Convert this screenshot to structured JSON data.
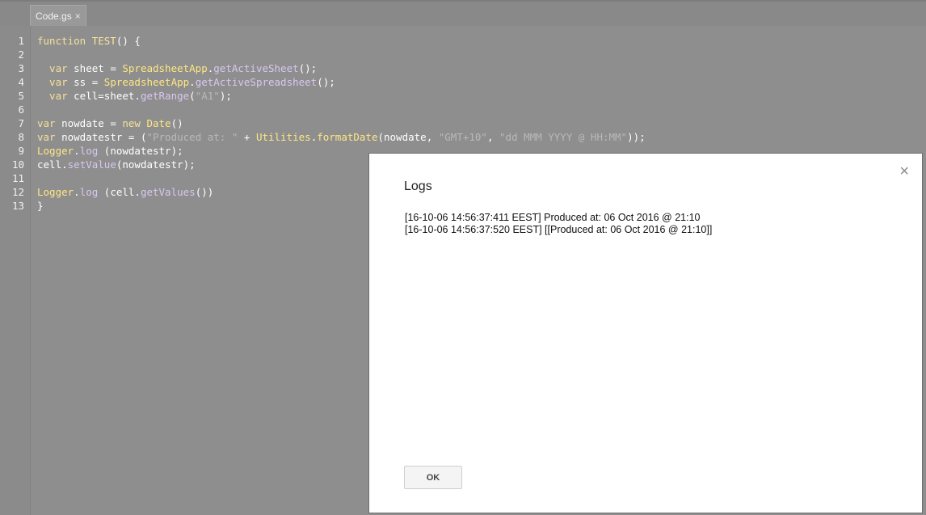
{
  "tabs": [
    {
      "label": "Code.gs",
      "close_glyph": "×"
    }
  ],
  "editor": {
    "lines": [
      {
        "no": "1",
        "tokens": [
          [
            "kw",
            "function "
          ],
          [
            "fn",
            "TEST"
          ],
          [
            "p",
            "() {"
          ]
        ]
      },
      {
        "no": "2",
        "tokens": []
      },
      {
        "no": "3",
        "tokens": [
          [
            "kw",
            "  var "
          ],
          [
            "v",
            "sheet"
          ],
          [
            "p",
            " = "
          ],
          [
            "cls",
            "SpreadsheetApp"
          ],
          [
            "p",
            "."
          ],
          [
            "m",
            "getActiveSheet"
          ],
          [
            "p",
            "();"
          ]
        ]
      },
      {
        "no": "4",
        "tokens": [
          [
            "kw",
            "  var "
          ],
          [
            "v",
            "ss"
          ],
          [
            "p",
            " = "
          ],
          [
            "cls",
            "SpreadsheetApp"
          ],
          [
            "p",
            "."
          ],
          [
            "m",
            "getActiveSpreadsheet"
          ],
          [
            "p",
            "();"
          ]
        ]
      },
      {
        "no": "5",
        "tokens": [
          [
            "kw",
            "  var "
          ],
          [
            "v",
            "cell"
          ],
          [
            "p",
            "=sheet."
          ],
          [
            "m",
            "getRange"
          ],
          [
            "p",
            "("
          ],
          [
            "s",
            "\"A1\""
          ],
          [
            "p",
            ");"
          ]
        ]
      },
      {
        "no": "6",
        "tokens": []
      },
      {
        "no": "7",
        "tokens": [
          [
            "kw",
            "var "
          ],
          [
            "v",
            "nowdate"
          ],
          [
            "p",
            " = "
          ],
          [
            "kw",
            "new "
          ],
          [
            "cls",
            "Date"
          ],
          [
            "p",
            "()"
          ]
        ]
      },
      {
        "no": "8",
        "tokens": [
          [
            "kw",
            "var "
          ],
          [
            "v",
            "nowdatestr"
          ],
          [
            "p",
            " = ("
          ],
          [
            "s",
            "\"Produced at: \""
          ],
          [
            "p",
            " + "
          ],
          [
            "cls",
            "Utilities"
          ],
          [
            "p",
            "."
          ],
          [
            "cls",
            "formatDate"
          ],
          [
            "p",
            "(nowdate, "
          ],
          [
            "s",
            "\"GMT+10\""
          ],
          [
            "p",
            ", "
          ],
          [
            "s",
            "\"dd MMM YYYY @ HH:MM\""
          ],
          [
            "p",
            "));"
          ]
        ]
      },
      {
        "no": "9",
        "tokens": [
          [
            "cls",
            "Logger"
          ],
          [
            "p",
            "."
          ],
          [
            "m",
            "log"
          ],
          [
            "p",
            " (nowdatestr);"
          ]
        ]
      },
      {
        "no": "10",
        "tokens": [
          [
            "p",
            "cell."
          ],
          [
            "m",
            "setValue"
          ],
          [
            "p",
            "(nowdatestr);"
          ]
        ]
      },
      {
        "no": "11",
        "tokens": []
      },
      {
        "no": "12",
        "tokens": [
          [
            "cls",
            "Logger"
          ],
          [
            "p",
            "."
          ],
          [
            "m",
            "log"
          ],
          [
            "p",
            " (cell."
          ],
          [
            "m",
            "getValues"
          ],
          [
            "p",
            "())"
          ]
        ]
      },
      {
        "no": "13",
        "tokens": [
          [
            "p",
            "}"
          ]
        ]
      }
    ]
  },
  "dialog": {
    "title": "Logs",
    "close_glyph": "×",
    "log_lines": [
      "[16-10-06 14:56:37:411 EEST] Produced at: 06 Oct 2016 @ 21:10",
      "[16-10-06 14:56:37:520 EEST] [[Produced at: 06 Oct 2016 @ 21:10]]"
    ],
    "ok_label": "OK"
  },
  "colors": {
    "overlay_gray": "#8e8e8e",
    "dialog_bg": "#ffffff",
    "button_bg": "#f4f4f4"
  }
}
